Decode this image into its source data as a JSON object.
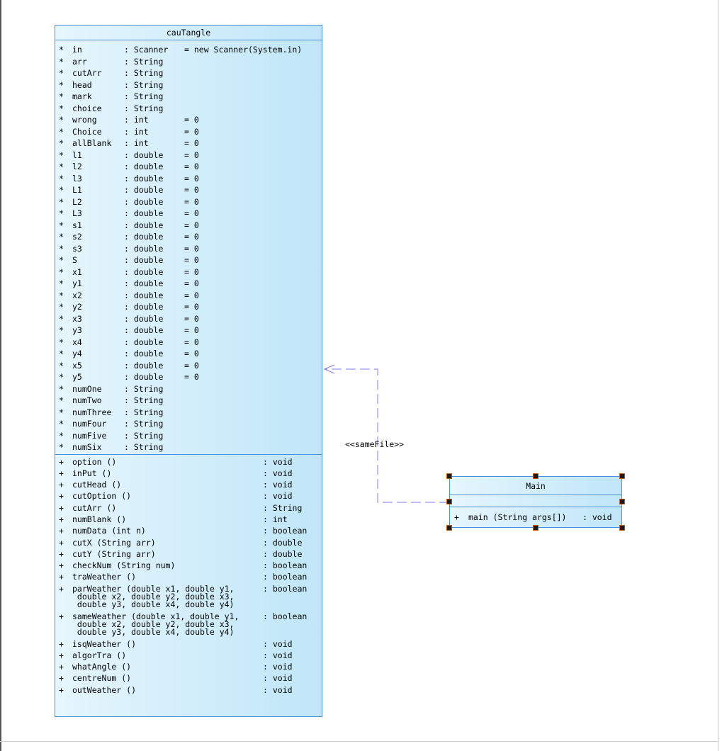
{
  "diagram": {
    "classes": {
      "cauTangle": {
        "name": "cauTangle",
        "attributes": [
          {
            "vis": "*",
            "name": "in",
            "type": ": Scanner",
            "init": "= new Scanner(System.in)"
          },
          {
            "vis": "*",
            "name": "arr",
            "type": ": String",
            "init": ""
          },
          {
            "vis": "*",
            "name": "cutArr",
            "type": ": String",
            "init": ""
          },
          {
            "vis": "*",
            "name": "head",
            "type": ": String",
            "init": ""
          },
          {
            "vis": "*",
            "name": "mark",
            "type": ": String",
            "init": ""
          },
          {
            "vis": "*",
            "name": "choice",
            "type": ": String",
            "init": ""
          },
          {
            "vis": "*",
            "name": "wrong",
            "type": ": int",
            "init": "= 0"
          },
          {
            "vis": "*",
            "name": "Choice",
            "type": ": int",
            "init": "= 0"
          },
          {
            "vis": "*",
            "name": "allBlank",
            "type": ": int",
            "init": "= 0"
          },
          {
            "vis": "*",
            "name": "l1",
            "type": ": double",
            "init": "= 0"
          },
          {
            "vis": "*",
            "name": "l2",
            "type": ": double",
            "init": "= 0"
          },
          {
            "vis": "*",
            "name": "l3",
            "type": ": double",
            "init": "= 0"
          },
          {
            "vis": "*",
            "name": "L1",
            "type": ": double",
            "init": "= 0"
          },
          {
            "vis": "*",
            "name": "L2",
            "type": ": double",
            "init": "= 0"
          },
          {
            "vis": "*",
            "name": "L3",
            "type": ": double",
            "init": "= 0"
          },
          {
            "vis": "*",
            "name": "s1",
            "type": ": double",
            "init": "= 0"
          },
          {
            "vis": "*",
            "name": "s2",
            "type": ": double",
            "init": "= 0"
          },
          {
            "vis": "*",
            "name": "s3",
            "type": ": double",
            "init": "= 0"
          },
          {
            "vis": "*",
            "name": "S",
            "type": ": double",
            "init": "= 0"
          },
          {
            "vis": "*",
            "name": "x1",
            "type": ": double",
            "init": "= 0"
          },
          {
            "vis": "*",
            "name": "y1",
            "type": ": double",
            "init": "= 0"
          },
          {
            "vis": "*",
            "name": "x2",
            "type": ": double",
            "init": "= 0"
          },
          {
            "vis": "*",
            "name": "y2",
            "type": ": double",
            "init": "= 0"
          },
          {
            "vis": "*",
            "name": "x3",
            "type": ": double",
            "init": "= 0"
          },
          {
            "vis": "*",
            "name": "y3",
            "type": ": double",
            "init": "= 0"
          },
          {
            "vis": "*",
            "name": "x4",
            "type": ": double",
            "init": "= 0"
          },
          {
            "vis": "*",
            "name": "y4",
            "type": ": double",
            "init": "= 0"
          },
          {
            "vis": "*",
            "name": "x5",
            "type": ": double",
            "init": "= 0"
          },
          {
            "vis": "*",
            "name": "y5",
            "type": ": double",
            "init": "= 0"
          },
          {
            "vis": "*",
            "name": "numOne",
            "type": ": String",
            "init": ""
          },
          {
            "vis": "*",
            "name": "numTwo",
            "type": ": String",
            "init": ""
          },
          {
            "vis": "*",
            "name": "numThree",
            "type": ": String",
            "init": ""
          },
          {
            "vis": "*",
            "name": "numFour",
            "type": ": String",
            "init": ""
          },
          {
            "vis": "*",
            "name": "numFive",
            "type": ": String",
            "init": ""
          },
          {
            "vis": "*",
            "name": "numSix",
            "type": ": String",
            "init": ""
          }
        ],
        "operations": [
          {
            "vis": "+",
            "sig": "option ()",
            "ret": ": void"
          },
          {
            "vis": "+",
            "sig": "inPut ()",
            "ret": ": void"
          },
          {
            "vis": "+",
            "sig": "cutHead ()",
            "ret": ": void"
          },
          {
            "vis": "+",
            "sig": "cutOption ()",
            "ret": ": void"
          },
          {
            "vis": "+",
            "sig": "cutArr ()",
            "ret": ": String"
          },
          {
            "vis": "+",
            "sig": "numBlank ()",
            "ret": ": int"
          },
          {
            "vis": "+",
            "sig": "numData (int n)",
            "ret": ": boolean"
          },
          {
            "vis": "+",
            "sig": "cutX (String arr)",
            "ret": ": double"
          },
          {
            "vis": "+",
            "sig": "cutY (String arr)",
            "ret": ": double"
          },
          {
            "vis": "+",
            "sig": "checkNum (String num)",
            "ret": ": boolean"
          },
          {
            "vis": "+",
            "sig": "traWeather ()",
            "ret": ": boolean"
          },
          {
            "vis": "+",
            "sig": "parWeather (double x1, double y1,\n double x2, double y2, double x3,\n double y3, double x4, double y4)",
            "ret": ": boolean"
          },
          {
            "vis": "+",
            "sig": "sameWeather (double x1, double y1,\n double x2, double y2, double x3,\n double y3, double x4, double y4)",
            "ret": ": boolean"
          },
          {
            "vis": "+",
            "sig": "isqWeather ()",
            "ret": ": void"
          },
          {
            "vis": "+",
            "sig": "algorTra ()",
            "ret": ": void"
          },
          {
            "vis": "+",
            "sig": "whatAngle ()",
            "ret": ": void"
          },
          {
            "vis": "+",
            "sig": "centreNum ()",
            "ret": ": void"
          },
          {
            "vis": "+",
            "sig": "outWeather ()",
            "ret": ": void"
          }
        ]
      },
      "Main": {
        "name": "Main",
        "operations": [
          {
            "vis": "+",
            "sig": "main (String args[])",
            "ret": ": void"
          }
        ]
      }
    },
    "relationships": [
      {
        "type": "dependency",
        "from": "Main",
        "to": "cauTangle",
        "stereotype": "<<sameFile>>"
      }
    ],
    "colors": {
      "box_border": "#4a90d9",
      "box_fill_left": "#e6f6fd",
      "box_fill_right": "#bfe6f8",
      "dependency_line": "#7b7bff",
      "handle_fill": "#1a1a1a",
      "handle_border": "#c25a00"
    }
  }
}
